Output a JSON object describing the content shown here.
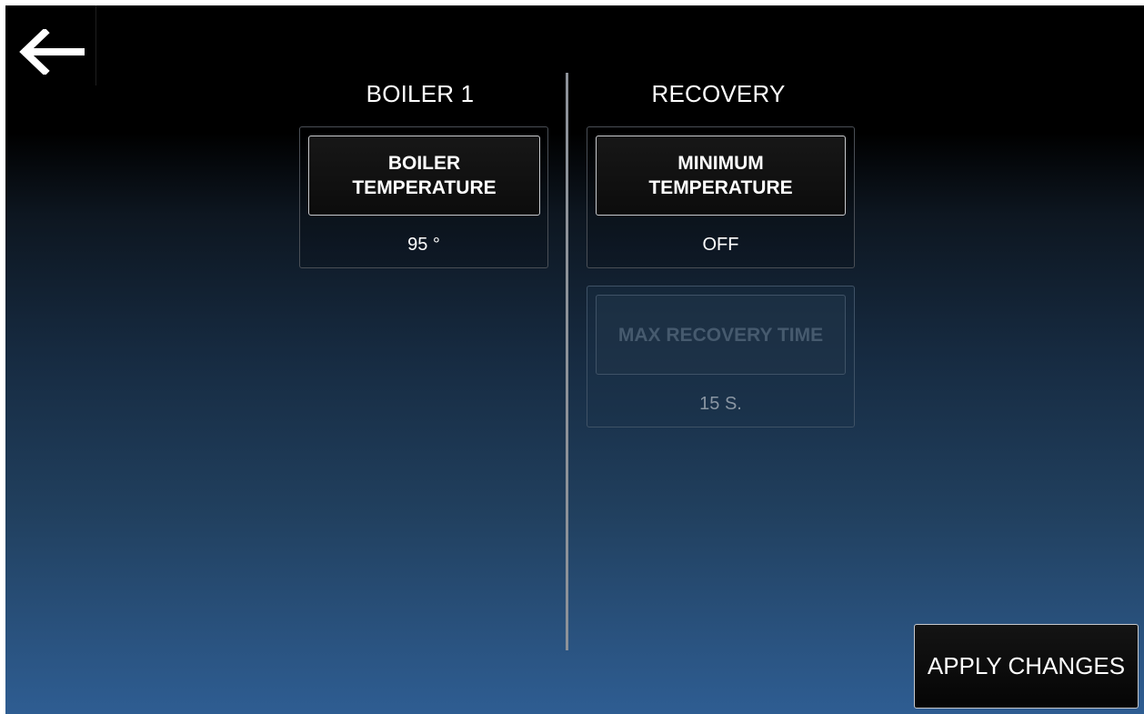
{
  "header": {
    "back_icon": "arrow-left-icon"
  },
  "boiler": {
    "title": "BOILER 1",
    "temperature": {
      "button_line1": "BOILER",
      "button_line2": "TEMPERATURE",
      "value": "95 °"
    }
  },
  "recovery": {
    "title": "RECOVERY",
    "minimum_temperature": {
      "button_line1": "MINIMUM",
      "button_line2": "TEMPERATURE",
      "value": "OFF"
    },
    "max_recovery_time": {
      "button_label": "MAX RECOVERY TIME",
      "value": "15 S.",
      "enabled": false
    }
  },
  "footer": {
    "apply_label": "APPLY CHANGES"
  },
  "colors": {
    "background_top": "#000000",
    "background_bottom": "#2e5d92",
    "button_border": "#c7c9cc",
    "divider": "#8d9299"
  }
}
